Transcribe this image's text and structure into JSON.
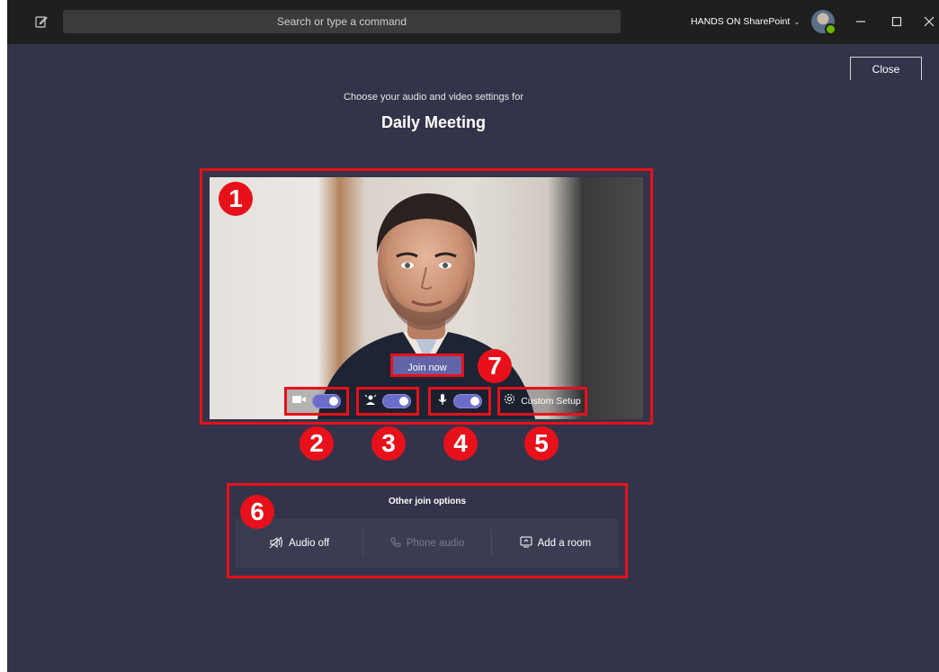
{
  "titlebar": {
    "search_placeholder": "Search or type a command",
    "org_name": "HANDS ON SharePoint",
    "org_chevron": "⌄"
  },
  "close_label": "Close",
  "prejoin": {
    "subtitle": "Choose your audio and video settings for",
    "meeting_title": "Daily Meeting",
    "join_label": "Join now",
    "custom_setup_label": "Custom Setup"
  },
  "other_options": {
    "title": "Other join options",
    "items": [
      {
        "label": "Audio off",
        "icon": "audio-off-icon",
        "enabled": true
      },
      {
        "label": "Phone audio",
        "icon": "phone-icon",
        "enabled": false
      },
      {
        "label": "Add a room",
        "icon": "cast-icon",
        "enabled": true
      }
    ]
  },
  "badges": [
    "1",
    "2",
    "3",
    "4",
    "5",
    "6",
    "7"
  ],
  "colors": {
    "background": "#33344a",
    "titlebar": "#1f1f1f",
    "accent": "#6264a7",
    "annotation": "#e8101a"
  }
}
